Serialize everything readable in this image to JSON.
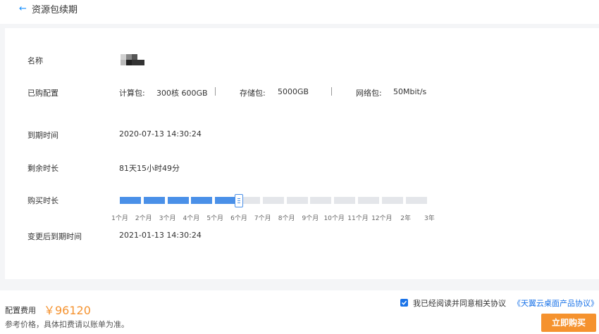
{
  "header": {
    "back_icon": "←",
    "title": "资源包续期"
  },
  "fields": {
    "name_label": "名称",
    "config_label": "已购配置",
    "expire_label": "到期时间",
    "remaining_label": "剩余时长",
    "duration_label": "购买时长",
    "new_expire_label": "变更后到期时间"
  },
  "config": {
    "compute_label": "计算包:",
    "compute_value": "300核 600GB",
    "storage_label": "存储包:",
    "storage_value": "5000GB",
    "network_label": "网络包:",
    "network_value": "50Mbit/s"
  },
  "values": {
    "expire_time": "2020-07-13 14:30:24",
    "remaining_time": "81天15小时49分",
    "new_expire_time": "2021-01-13 14:30:24"
  },
  "duration": {
    "options": [
      "1个月",
      "2个月",
      "3个月",
      "4个月",
      "5个月",
      "6个月",
      "7个月",
      "8个月",
      "9个月",
      "10个月",
      "11个月",
      "12个月",
      "2年",
      "3年"
    ],
    "selected_index": 5,
    "active_color": "#4a90e8",
    "inactive_color": "#e4e6ea"
  },
  "footer": {
    "fee_label": "配置费用",
    "fee_amount": "￥96120",
    "fee_note": "参考价格，具体扣费请以账单为准。",
    "agree_text": "我已经阅读并同意相关协议",
    "agree_link": "《天翼云桌面产品协议》",
    "agree_checked": true,
    "buy_button": "立即购买",
    "accent_color": "#f5922e"
  }
}
